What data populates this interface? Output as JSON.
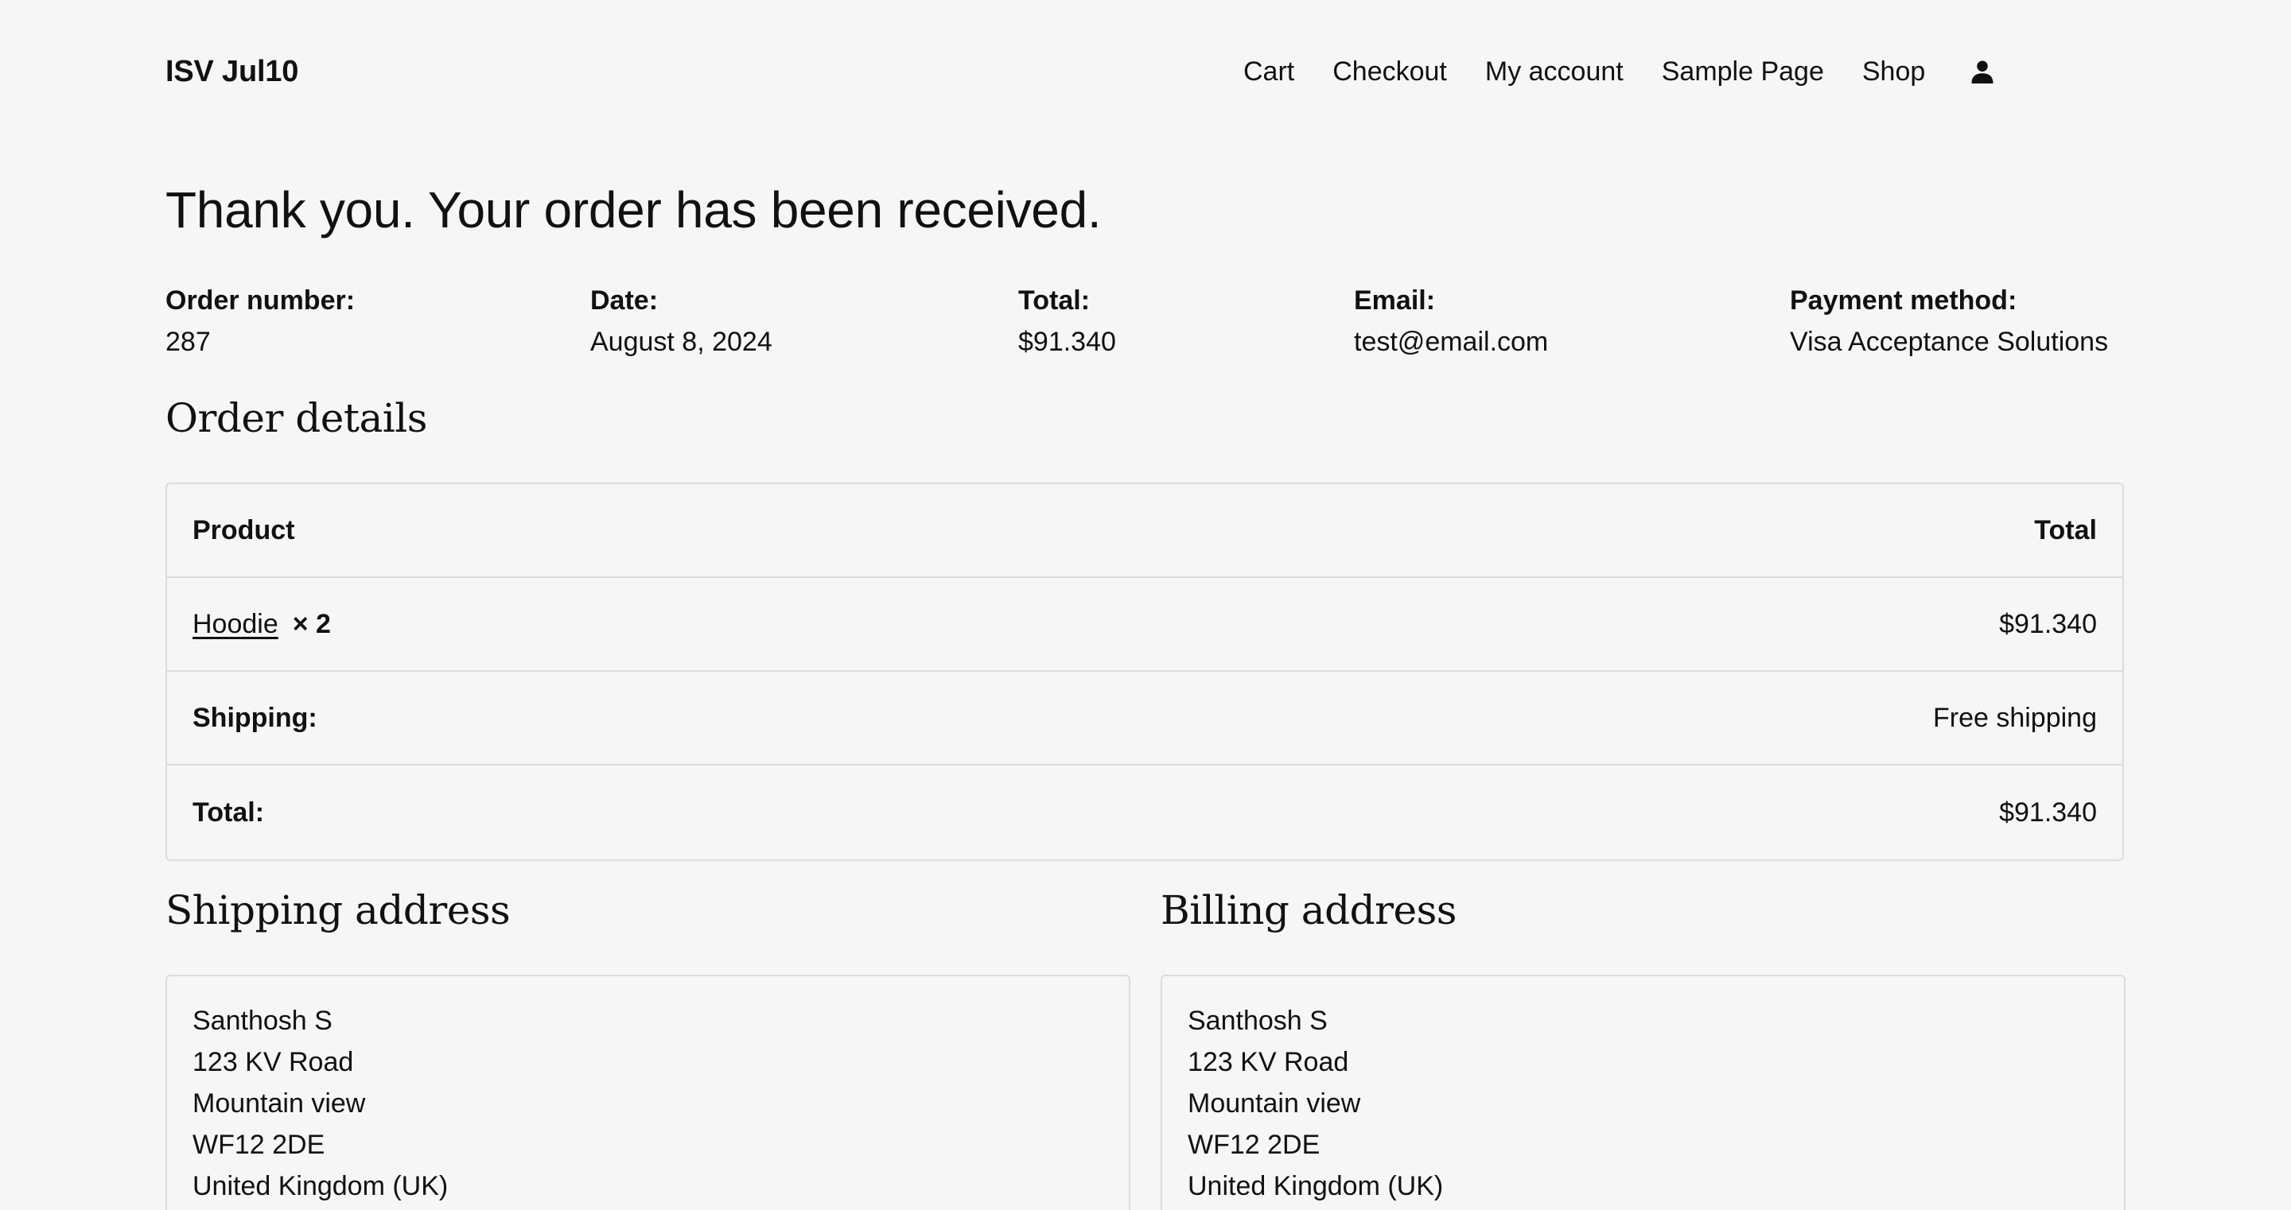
{
  "header": {
    "site_title": "ISV Jul10",
    "nav": [
      "Cart",
      "Checkout",
      "My account",
      "Sample Page",
      "Shop"
    ],
    "account_icon": "user-icon"
  },
  "thank_you": "Thank you. Your order has been received.",
  "overview": {
    "order_number": {
      "label": "Order number:",
      "value": "287"
    },
    "date": {
      "label": "Date:",
      "value": "August 8, 2024"
    },
    "total": {
      "label": "Total:",
      "value": "$91.340"
    },
    "email": {
      "label": "Email:",
      "value": "test@email.com"
    },
    "payment_method": {
      "label": "Payment method:",
      "value": "Visa Acceptance Solutions"
    }
  },
  "order_details": {
    "heading": "Order details",
    "columns": [
      "Product",
      "Total"
    ],
    "item": {
      "name": "Hoodie",
      "qty": "× 2",
      "total": "$91.340"
    },
    "shipping": {
      "label": "Shipping:",
      "value": "Free shipping"
    },
    "total": {
      "label": "Total:",
      "value": "$91.340"
    }
  },
  "shipping_address": {
    "heading": "Shipping address",
    "lines": [
      "Santhosh S",
      "123 KV Road",
      "Mountain view",
      "WF12 2DE",
      "United Kingdom (UK)"
    ]
  },
  "billing_address": {
    "heading": "Billing address",
    "lines": [
      "Santhosh S",
      "123 KV Road",
      "Mountain view",
      "WF12 2DE",
      "United Kingdom (UK)"
    ]
  }
}
